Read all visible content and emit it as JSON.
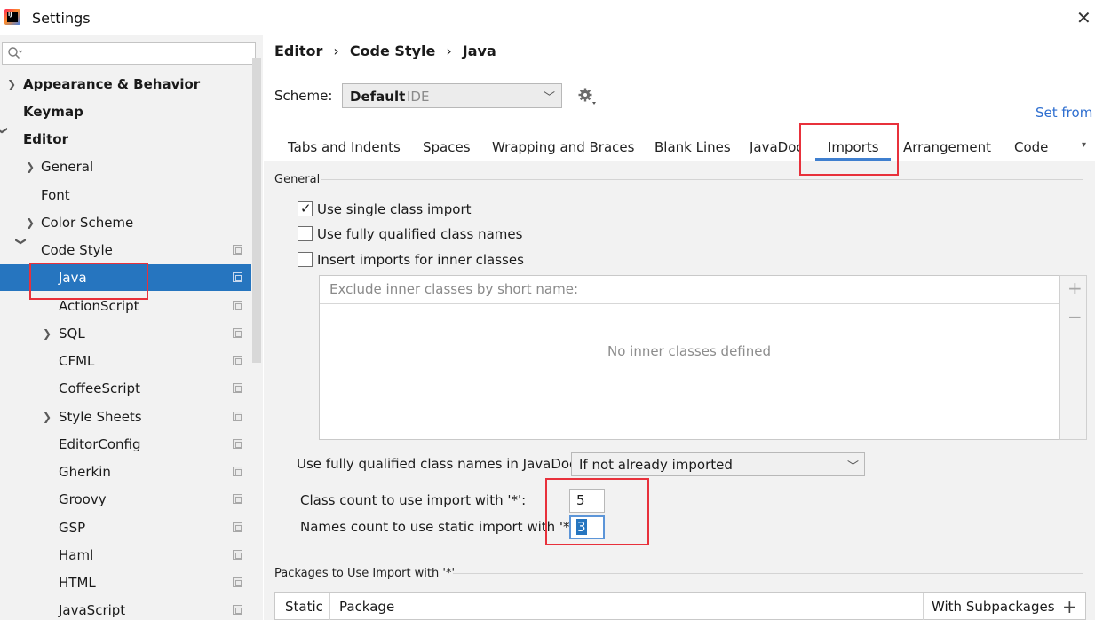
{
  "window": {
    "title": "Settings",
    "logo_text": "IJ"
  },
  "sidebar": {
    "search": {
      "placeholder": "",
      "value": ""
    },
    "items": [
      {
        "label": "Appearance & Behavior"
      },
      {
        "label": "Keymap"
      },
      {
        "label": "Editor"
      },
      {
        "label": "General"
      },
      {
        "label": "Font"
      },
      {
        "label": "Color Scheme"
      },
      {
        "label": "Code Style"
      },
      {
        "label": "Java"
      },
      {
        "label": "ActionScript"
      },
      {
        "label": "SQL"
      },
      {
        "label": "CFML"
      },
      {
        "label": "CoffeeScript"
      },
      {
        "label": "Style Sheets"
      },
      {
        "label": "EditorConfig"
      },
      {
        "label": "Gherkin"
      },
      {
        "label": "Groovy"
      },
      {
        "label": "GSP"
      },
      {
        "label": "Haml"
      },
      {
        "label": "HTML"
      },
      {
        "label": "JavaScript"
      }
    ]
  },
  "breadcrumb": {
    "parts": [
      "Editor",
      "Code Style",
      "Java"
    ]
  },
  "scheme": {
    "label": "Scheme:",
    "name": "Default",
    "type": "IDE"
  },
  "set_from_link": "Set from",
  "tabs": [
    "Tabs and Indents",
    "Spaces",
    "Wrapping and Braces",
    "Blank Lines",
    "JavaDoc",
    "Imports",
    "Arrangement",
    "Code"
  ],
  "active_tab": "Imports",
  "general": {
    "section_title": "General",
    "use_single_class_import": {
      "label": "Use single class import",
      "checked": true
    },
    "use_fully_qualified": {
      "label": "Use fully qualified class names",
      "checked": false
    },
    "insert_imports_inner": {
      "label": "Insert imports for inner classes",
      "checked": false
    },
    "exclude_header": "Exclude inner classes by short name:",
    "exclude_empty": "No inner classes defined",
    "add_symbol": "+",
    "remove_symbol": "−"
  },
  "javadoc": {
    "label": "Use fully qualified class names in JavaDoc:",
    "value": "If not already imported"
  },
  "class_count": {
    "label": "Class count to use import with '*':",
    "value": "5"
  },
  "names_count": {
    "label": "Names count to use static import with '*':",
    "value": "3"
  },
  "packages": {
    "section_title": "Packages to Use Import with '*'",
    "columns": [
      "Static",
      "Package",
      "With Subpackages"
    ],
    "add_symbol": "+"
  },
  "colors": {
    "selection": "#2675bf",
    "highlight_box": "#e8313b",
    "link": "#2f6fd0"
  }
}
